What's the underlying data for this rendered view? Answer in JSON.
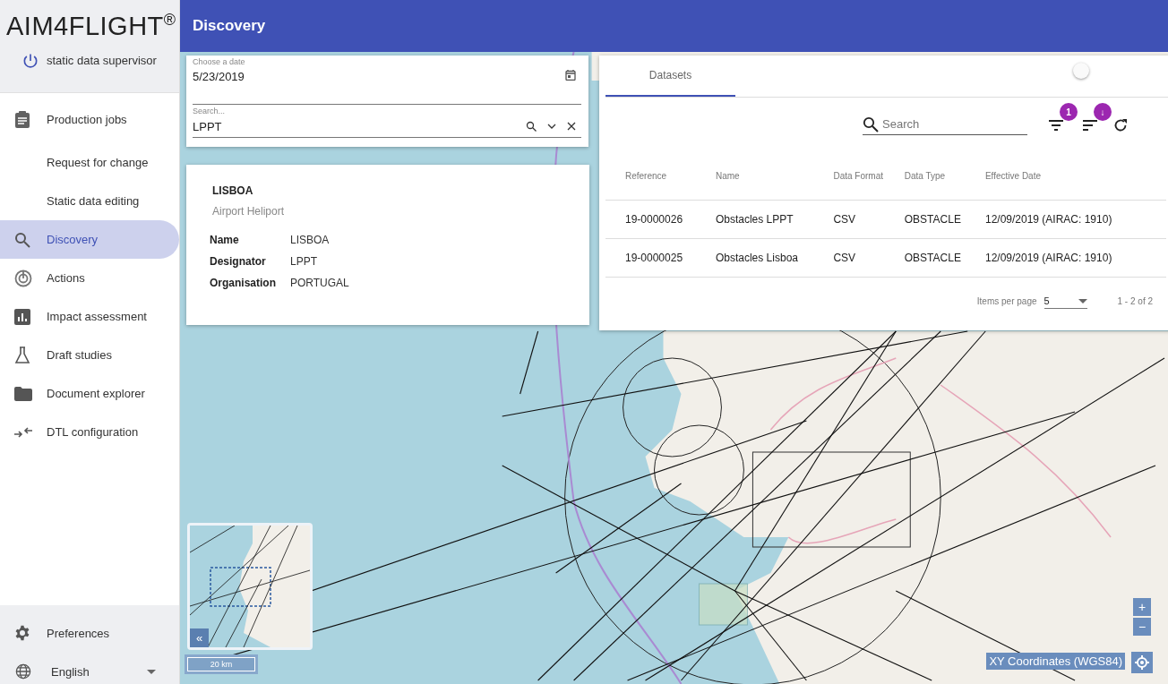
{
  "app": {
    "logo": "AIM4FLIGHT",
    "logo_mark": "®",
    "user": "static data supervisor"
  },
  "nav": [
    {
      "label": "Production jobs",
      "kind": "clipboard",
      "selected": false
    },
    {
      "label": "Request for change",
      "kind": "plain",
      "selected": false
    },
    {
      "label": "Static data editing",
      "kind": "plain",
      "selected": false
    },
    {
      "label": "Discovery",
      "kind": "search",
      "selected": true
    },
    {
      "label": "Actions",
      "kind": "target",
      "selected": false
    },
    {
      "label": "Impact assessment",
      "kind": "chart",
      "selected": false
    },
    {
      "label": "Draft studies",
      "kind": "flask",
      "selected": false
    },
    {
      "label": "Document explorer",
      "kind": "folder",
      "selected": false
    },
    {
      "label": "DTL configuration",
      "kind": "arrows",
      "selected": false
    }
  ],
  "footer": {
    "preferences": "Preferences",
    "language": "English"
  },
  "header": {
    "title": "Discovery"
  },
  "filter": {
    "date_label": "Choose a date",
    "date": "5/23/2019",
    "search_label": "Search...",
    "search": "LPPT"
  },
  "feature": {
    "title": "LISBOA",
    "subtitle": "Airport Heliport",
    "fields": [
      {
        "label": "Name",
        "value": "LISBOA"
      },
      {
        "label": "Designator",
        "value": "LPPT"
      },
      {
        "label": "Organisation",
        "value": "PORTUGAL"
      }
    ]
  },
  "datasets": {
    "toggle_on": false,
    "tabs": [
      {
        "label": "Datasets",
        "selected": true
      }
    ],
    "search_placeholder": "Search",
    "filter_badge": "1",
    "sort_badge": "↓",
    "columns": [
      "Reference",
      "Name",
      "Data Format",
      "Data Type",
      "Effective Date"
    ],
    "rows": [
      [
        "19-0000026",
        "Obstacles LPPT",
        "CSV",
        "OBSTACLE",
        "12/09/2019 (AIRAC: 1910)"
      ],
      [
        "19-0000025",
        "Obstacles Lisboa",
        "CSV",
        "OBSTACLE",
        "12/09/2019 (AIRAC: 1910)"
      ]
    ],
    "items_per_page_label": "Items per page",
    "items_per_page": "5",
    "range": "1 - 2 of 2"
  },
  "map": {
    "scale": "20 km",
    "coordinates": "XY Coordinates (WGS84)",
    "zoom_in": "+",
    "zoom_out": "−",
    "overview_toggle": "«"
  }
}
